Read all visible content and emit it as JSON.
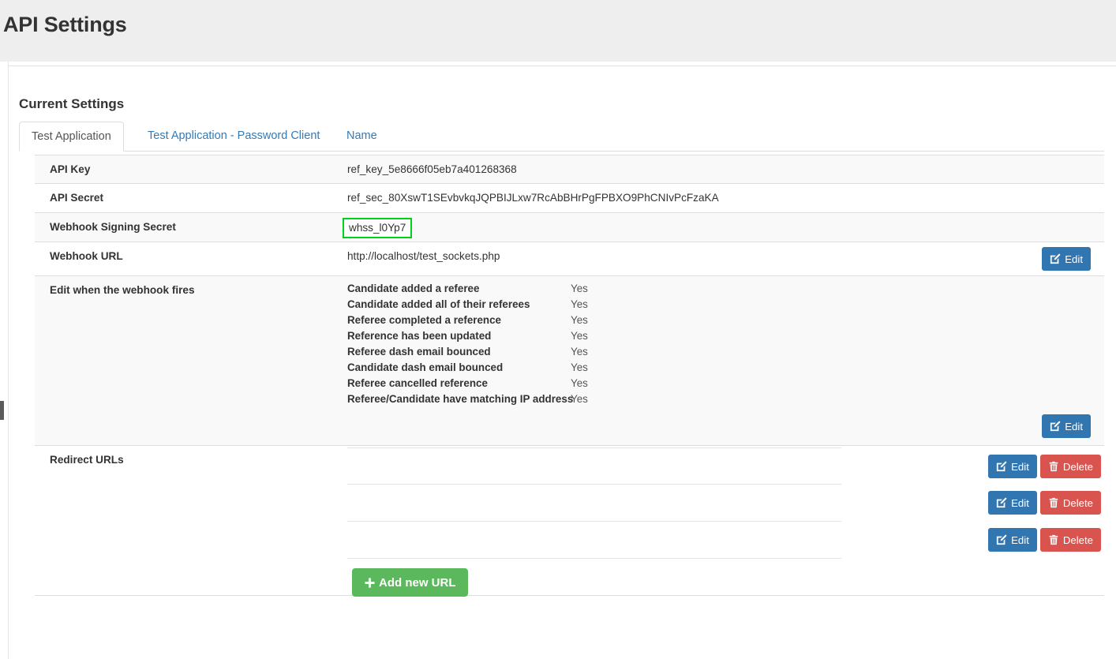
{
  "page": {
    "title": "API Settings"
  },
  "section": {
    "title": "Current Settings"
  },
  "tabs": [
    {
      "label": "Test Application",
      "active": true
    },
    {
      "label": "Test Application - Password Client",
      "active": false
    },
    {
      "label": "Name",
      "active": false
    }
  ],
  "settings": {
    "api_key": {
      "label": "API Key",
      "value": "ref_key_5e8666f05eb7a401268368"
    },
    "api_secret": {
      "label": "API Secret",
      "value": "ref_sec_80XswT1SEvbvkqJQPBIJLxw7RcAbBHrPgFPBXO9PhCNIvPcFzaKA"
    },
    "webhook_signing_secret": {
      "label": "Webhook Signing Secret",
      "value": "whss_l0Yp7",
      "highlight_color": "#00d21a"
    },
    "webhook_url": {
      "label": "Webhook URL",
      "value": "http://localhost/test_sockets.php",
      "edit_label": "Edit"
    },
    "webhook_events": {
      "label": "Edit when the webhook fires",
      "edit_label": "Edit",
      "items": [
        {
          "name": "Candidate added a referee",
          "value": "Yes"
        },
        {
          "name": "Candidate added all of their referees",
          "value": "Yes"
        },
        {
          "name": "Referee completed a reference",
          "value": "Yes"
        },
        {
          "name": "Reference has been updated",
          "value": "Yes"
        },
        {
          "name": "Referee dash email bounced",
          "value": "Yes"
        },
        {
          "name": "Candidate dash email bounced",
          "value": "Yes"
        },
        {
          "name": "Referee cancelled reference",
          "value": "Yes"
        },
        {
          "name": "Referee/Candidate have matching IP address",
          "value": "Yes"
        }
      ]
    },
    "redirect_urls": {
      "label": "Redirect URLs",
      "edit_label": "Edit",
      "delete_label": "Delete",
      "add_label": "Add new URL",
      "rows": [
        {
          "url": ""
        },
        {
          "url": ""
        },
        {
          "url": ""
        }
      ]
    }
  },
  "colors": {
    "header_band": "#eeeeee",
    "edit_button": "#3276b1",
    "delete_button": "#d9534f",
    "add_button": "#5cb85c",
    "tab_link": "#337ab7",
    "highlight_border": "#00d21a"
  }
}
